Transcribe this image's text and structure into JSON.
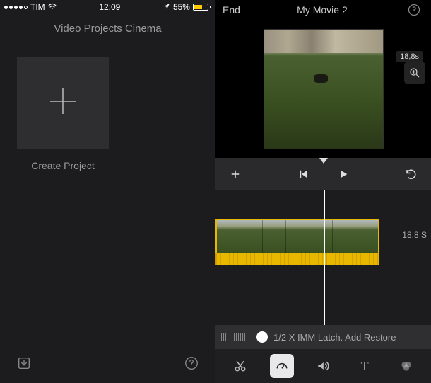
{
  "status": {
    "carrier": "TIM",
    "time": "12:09",
    "battery_pct": "55%"
  },
  "left": {
    "header": "Video Projects Cinema",
    "create_label": "Create Project",
    "bottom_export": "export-icon",
    "bottom_help": "help-icon"
  },
  "right": {
    "end_label": "End",
    "title": "My Movie 2",
    "clip_duration": "18,8s",
    "timeline_duration": "18.8 S",
    "speed_label": "1/2 X IMM Latch. Add Restore",
    "tools": {
      "scissors": "cut-icon",
      "speed": "speed-icon",
      "volume": "volume-icon",
      "text": "T",
      "filter": "filter-icon"
    }
  }
}
